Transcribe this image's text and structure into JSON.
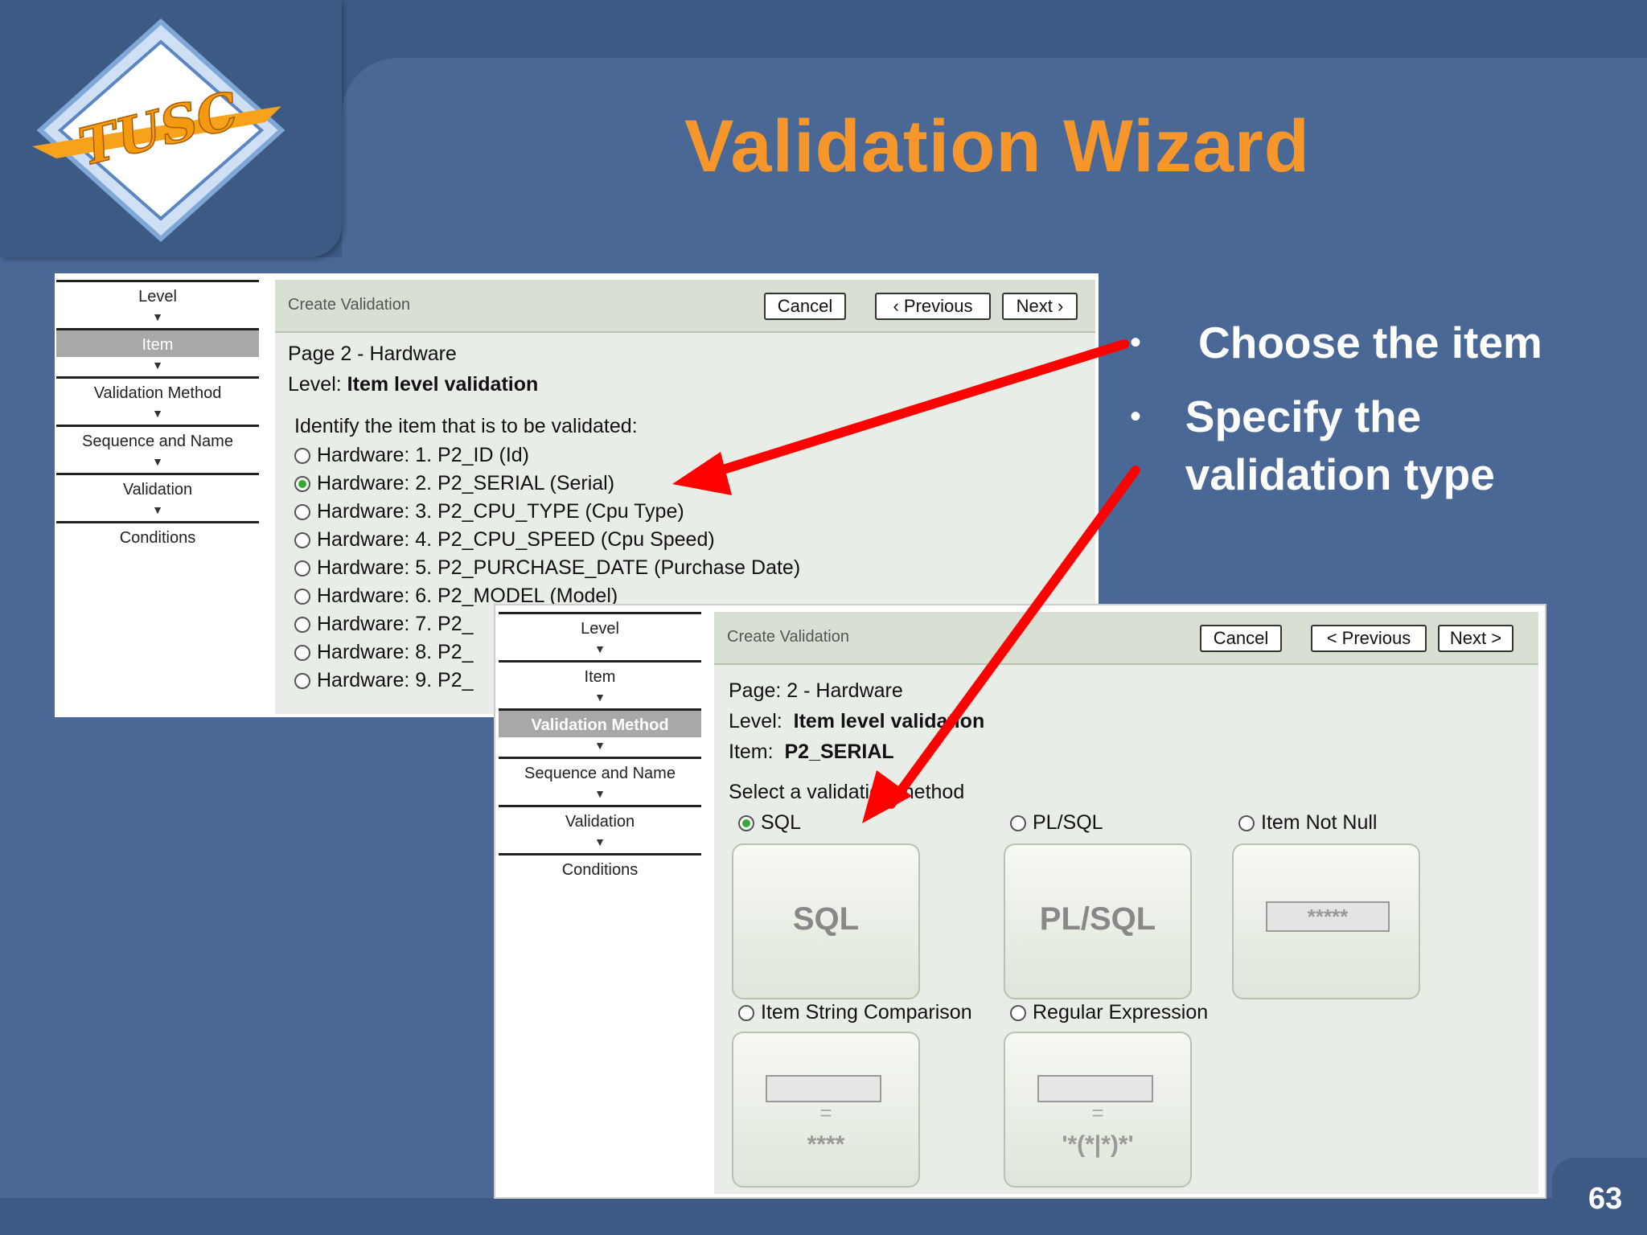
{
  "slide": {
    "title": "Validation Wizard",
    "bullets": [
      "Choose the item",
      "Specify the validation type"
    ],
    "page_number": "63",
    "logo_text": "TUSC"
  },
  "screen1": {
    "steps": [
      "Level",
      "Item",
      "Validation Method",
      "Sequence and Name",
      "Validation",
      "Conditions"
    ],
    "header_title": "Create Validation",
    "buttons": {
      "cancel": "Cancel",
      "previous": "‹ Previous",
      "next": "Next ›"
    },
    "page_line": "Page 2 - Hardware",
    "level_line_label": "Level:",
    "level_line_value": "Item level validation",
    "prompt": "Identify the item that is to be validated:",
    "items": [
      "Hardware: 1. P2_ID (Id)",
      "Hardware: 2. P2_SERIAL (Serial)",
      "Hardware: 3. P2_CPU_TYPE (Cpu Type)",
      "Hardware: 4. P2_CPU_SPEED (Cpu Speed)",
      "Hardware: 5. P2_PURCHASE_DATE (Purchase Date)",
      "Hardware: 6. P2_MODEL (Model)",
      "Hardware: 7. P2_",
      "Hardware: 8. P2_",
      "Hardware: 9. P2_"
    ],
    "selected_index": 1
  },
  "screen2": {
    "steps": [
      "Level",
      "Item",
      "Validation Method",
      "Sequence and Name",
      "Validation",
      "Conditions"
    ],
    "header_title": "Create Validation",
    "buttons": {
      "cancel": "Cancel",
      "previous": "< Previous",
      "next": "Next >"
    },
    "page_line": "Page: 2 - Hardware",
    "level_label": "Level:",
    "level_value": "Item level validation",
    "item_label": "Item:",
    "item_value": "P2_SERIAL",
    "prompt": "Select a validation method",
    "methods": [
      {
        "label": "SQL",
        "tile": "SQL"
      },
      {
        "label": "PL/SQL",
        "tile": "PL/SQL"
      },
      {
        "label": "Item Not Null",
        "tile": "*****"
      },
      {
        "label": "Item String Comparison",
        "tile": "****"
      },
      {
        "label": "Regular Expression",
        "tile": "'*(*|*)*'"
      }
    ],
    "selected_method": 0
  },
  "colors": {
    "title": "#f7972b",
    "arrow": "#ff0000",
    "background": "#4a6896"
  }
}
